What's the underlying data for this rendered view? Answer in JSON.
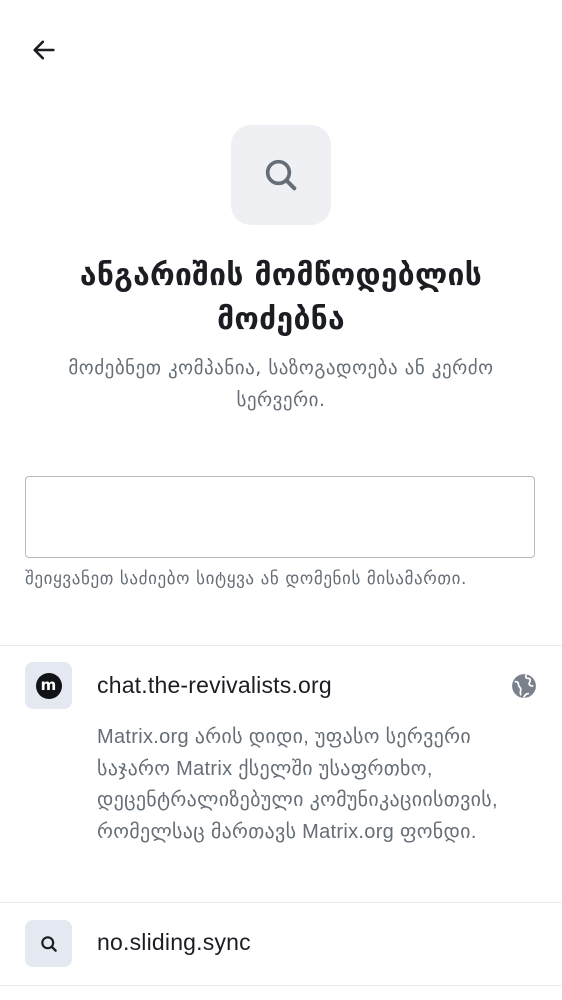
{
  "header": {
    "back_icon": "arrow-left-icon"
  },
  "hero": {
    "icon": "search-icon",
    "title": "ანგარიშის მომწოდებლის მოძებნა",
    "subtitle": "მოძებნეთ კომპანია, საზოგადოება ან კერძო სერვერი."
  },
  "search": {
    "value": "",
    "placeholder": "",
    "helper": "შეიყვანეთ საძიებო სიტყვა ან დომენის მისამართი."
  },
  "results": [
    {
      "name": "chat.the-revivalists.org",
      "avatar_letter": "m",
      "avatar_icon": "matrix-logo-icon",
      "trailing_icon": "globe-icon",
      "description": "Matrix.org არის დიდი, უფასო სერვერი საჯარო Matrix ქსელში უსაფრთხო, დეცენტრალიზებული კომუნიკაციისთვის, რომელსაც მართავს Matrix.org ფონდი."
    },
    {
      "name": "no.sliding.sync",
      "avatar_icon": "search-icon"
    }
  ],
  "colors": {
    "text_primary": "#1b1d22",
    "text_secondary": "#656d77",
    "icon_bg": "#eef0f4",
    "divider": "#e8eaee"
  }
}
